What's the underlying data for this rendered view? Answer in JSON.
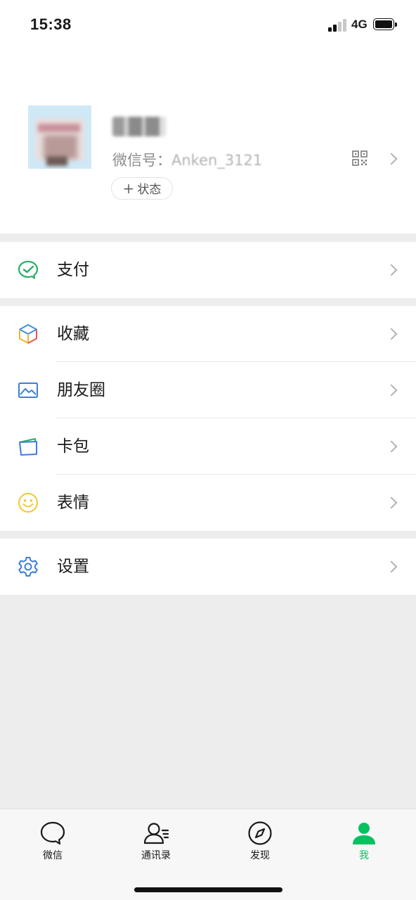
{
  "status_bar": {
    "time": "15:38",
    "network": "4G"
  },
  "profile": {
    "wechat_id_label": "微信号：",
    "wechat_id_value": "Anken_3121",
    "status_button_plus": "+",
    "status_button_label": "状态"
  },
  "menu": {
    "groups": [
      [
        {
          "label": "支付",
          "icon": "wechat-pay-icon"
        }
      ],
      [
        {
          "label": "收藏",
          "icon": "favorites-cube-icon"
        },
        {
          "label": "朋友圈",
          "icon": "moments-picture-icon"
        },
        {
          "label": "卡包",
          "icon": "card-wallet-icon"
        },
        {
          "label": "表情",
          "icon": "smiley-icon"
        }
      ],
      [
        {
          "label": "设置",
          "icon": "gear-icon"
        }
      ]
    ]
  },
  "tab_bar": {
    "tabs": [
      {
        "label": "微信",
        "icon": "chat-bubble-icon",
        "active": false
      },
      {
        "label": "通讯录",
        "icon": "contacts-icon",
        "active": false
      },
      {
        "label": "发现",
        "icon": "compass-icon",
        "active": false
      },
      {
        "label": "我",
        "icon": "person-icon",
        "active": true
      }
    ]
  },
  "colors": {
    "accent": "#07c160",
    "background": "#ededed",
    "pay_green": "#2aae67",
    "blue": "#3d7ed4",
    "yellow": "#f4c72f"
  }
}
